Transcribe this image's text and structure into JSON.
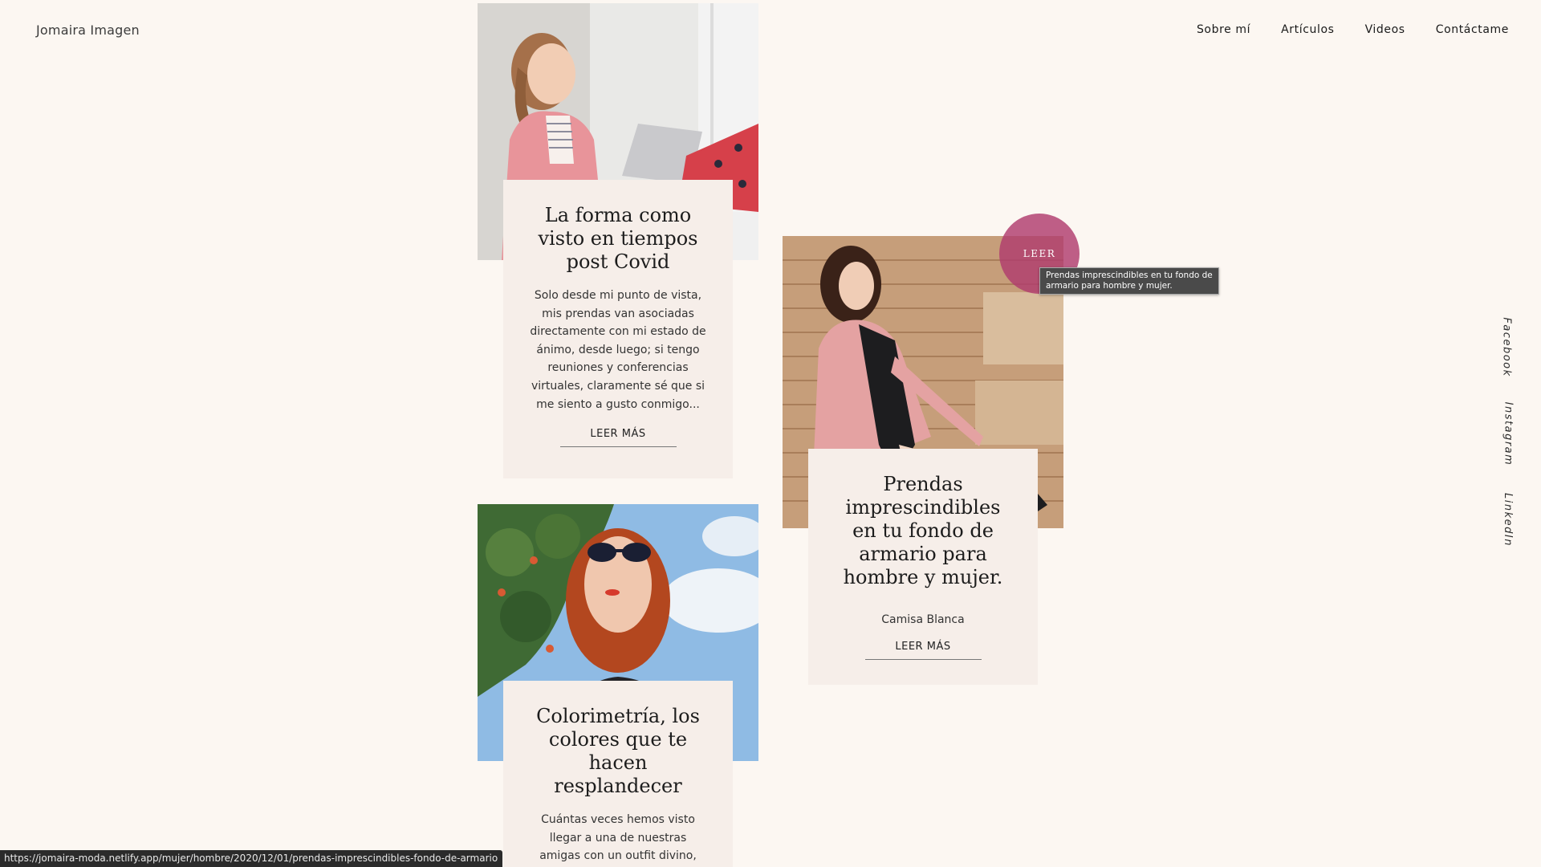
{
  "brand": "Jomaira Imagen",
  "nav": [
    "Sobre mí",
    "Artículos",
    "Videos",
    "Contáctame"
  ],
  "cards": [
    {
      "title": "La forma como visto en tiempos post Covid",
      "text": "Solo desde mi punto de vista, mis prendas van asociadas directamente con mi estado de ánimo, desde luego; si tengo reuniones y conferencias virtuales, claramente sé que si me siento a gusto conmigo...",
      "read_more": "LEER MÁS"
    },
    {
      "title": "Prendas imprescindibles en tu fondo de armario para hombre y mujer.",
      "subtitle": "Camisa Blanca",
      "read_more": "LEER MÁS"
    },
    {
      "title": "Colorimetría, los colores que te hacen resplandecer",
      "text": "Cuántas veces hemos visto llegar a una de nuestras amigas con un outfit divino, que resalta el color"
    }
  ],
  "leer_bubble": "LEER",
  "tooltip": "Prendas imprescindibles en tu fondo de armario para hombre y mujer.",
  "social": [
    "Facebook",
    "Instagram",
    "LinkedIn"
  ],
  "status_url": "https://jomaira-moda.netlify.app/mujer/hombre/2020/12/01/prendas-imprescindibles-fondo-de-armario"
}
